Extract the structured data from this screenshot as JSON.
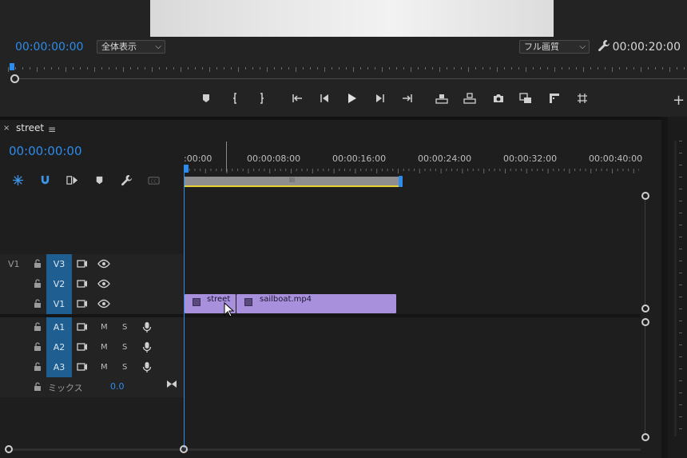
{
  "monitor": {
    "current_timecode": "00:00:00:00",
    "duration_timecode": "00:00:20:00",
    "zoom_select": "全体表示",
    "quality_select": "フル画質",
    "transport_buttons": [
      "add-marker",
      "mark-in",
      "mark-out",
      "go-to-in",
      "step-back",
      "play",
      "step-forward",
      "go-to-out",
      "lift",
      "extract",
      "export-frame",
      "comparison-view",
      "safe-margins",
      "grid"
    ]
  },
  "sequence": {
    "tab_close": "×",
    "tab_name": "street",
    "tab_menu": "≡",
    "timecode": "00:00:00:00",
    "ruler_labels": [
      ":00:00",
      "00:00:08:00",
      "00:00:16:00",
      "00:00:24:00",
      "00:00:32:00",
      "00:00:40:00"
    ],
    "work_area_handle": "III",
    "video_tracks": [
      {
        "name": "V3",
        "source_patch": "V1"
      },
      {
        "name": "V2",
        "source_patch": ""
      },
      {
        "name": "V1",
        "source_patch": ""
      }
    ],
    "audio_tracks": [
      {
        "name": "A1",
        "mute": "M",
        "solo": "S"
      },
      {
        "name": "A2",
        "mute": "M",
        "solo": "S"
      },
      {
        "name": "A3",
        "mute": "M",
        "solo": "S"
      }
    ],
    "mix": {
      "label": "ミックス",
      "value": "0.0"
    },
    "clips": [
      {
        "name": "street",
        "track": "V1"
      },
      {
        "name": "sailboat.mp4",
        "track": "V1"
      }
    ]
  },
  "colors": {
    "accent": "#2d8ceb",
    "track_selected": "#1f5e90",
    "clip": "#a890dc",
    "work_area_yellow": "#e6d233"
  }
}
